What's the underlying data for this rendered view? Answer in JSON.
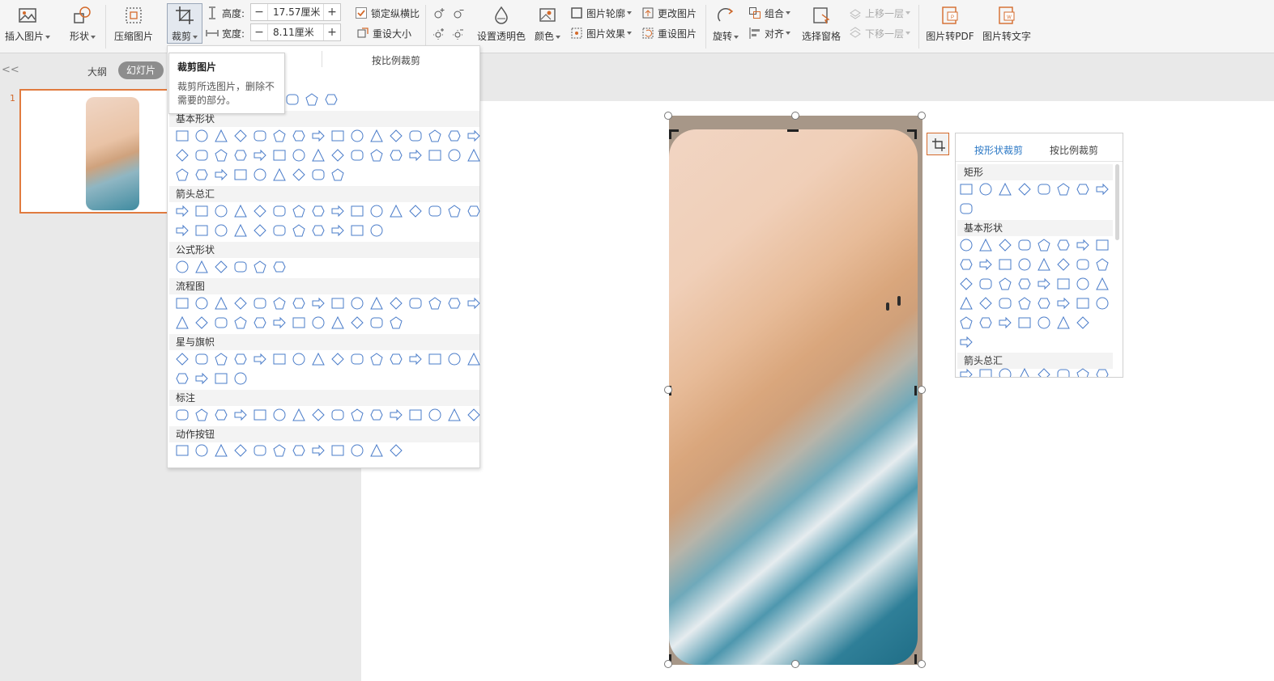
{
  "ribbon": {
    "insert_picture": "插入图片",
    "shapes": "形状",
    "compress": "压缩图片",
    "crop": "裁剪",
    "height_label": "高度:",
    "height_value": "17.57厘米",
    "width_label": "宽度:",
    "width_value": "8.11厘米",
    "lock_ratio": "锁定纵横比",
    "reset_size": "重设大小",
    "set_transparent": "设置透明色",
    "color": "颜色",
    "picture_outline": "图片轮廓",
    "picture_effects": "图片效果",
    "change_picture": "更改图片",
    "reset_picture": "重设图片",
    "rotate": "旋转",
    "group": "组合",
    "align": "对齐",
    "selection_pane": "选择窗格",
    "bring_forward": "上移一层",
    "send_backward": "下移一层",
    "to_pdf": "图片转PDF",
    "to_text": "图片转文字"
  },
  "left_panel": {
    "collapse_glyph": "<<",
    "tab_outline": "大纲",
    "tab_slides": "幻灯片",
    "slide_number": "1"
  },
  "tooltip": {
    "title": "裁剪图片",
    "description": "裁剪所选图片，删除不需要的部分。"
  },
  "dropdown": {
    "tab_ratio": "按比例裁剪",
    "categories": [
      "基本形状",
      "箭头总汇",
      "公式形状",
      "流程图",
      "星与旗帜",
      "标注",
      "动作按钮"
    ]
  },
  "right_panel": {
    "tab_shape": "按形状裁剪",
    "tab_ratio": "按比例裁剪",
    "categories": [
      "矩形",
      "基本形状",
      "箭头总汇"
    ]
  },
  "colors": {
    "accent": "#d46a2b",
    "shape_stroke": "#4a7cc9",
    "tab_active": "#2b78c5"
  }
}
